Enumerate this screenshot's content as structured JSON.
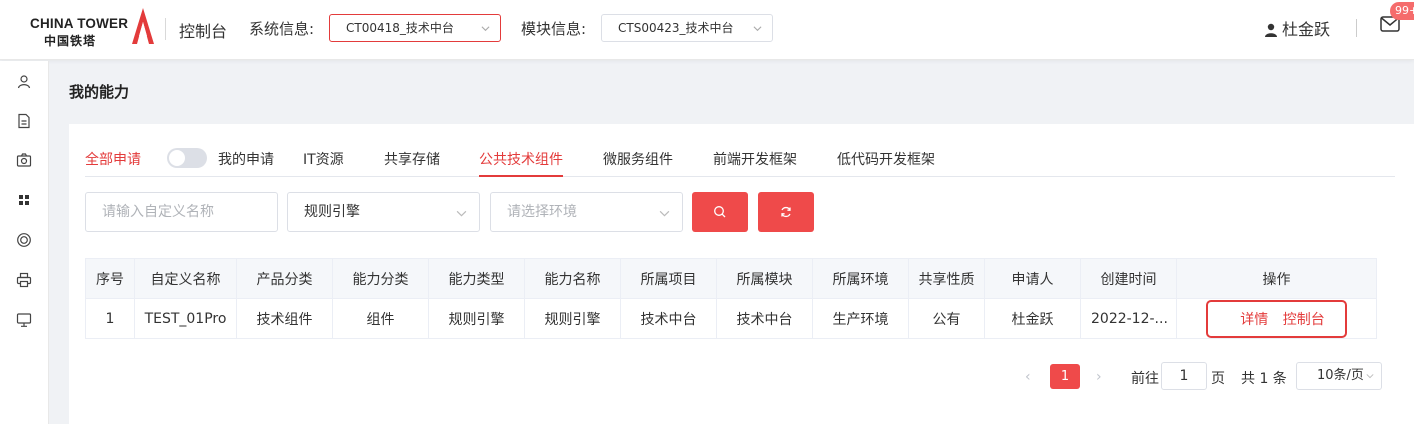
{
  "brand": {
    "name_en": "CHINA TOWER",
    "name_cn": "中国铁塔",
    "accent": "#e33b3b"
  },
  "header": {
    "console_title": "控制台",
    "system_label": "系统信息:",
    "system_value": "CT00418_技术中台",
    "module_label": "模块信息:",
    "module_value": "CTS00423_技术中台",
    "user_name": "杜金跃",
    "mail_badge": "99+"
  },
  "sidebar": {
    "icons": [
      "user-icon",
      "document-icon",
      "camera-icon",
      "grid-icon",
      "target-icon",
      "printer-icon",
      "monitor-icon"
    ]
  },
  "page": {
    "title": "我的能力"
  },
  "tabs": {
    "all_requests": "全部申请",
    "my_requests": "我的申请",
    "items": [
      "IT资源",
      "共享存储",
      "公共技术组件",
      "微服务组件",
      "前端开发框架",
      "低代码开发框架"
    ],
    "active": "公共技术组件"
  },
  "filters": {
    "name_placeholder": "请输入自定义名称",
    "category_value": "规则引擎",
    "env_placeholder": "请选择环境"
  },
  "table": {
    "headers": [
      "序号",
      "自定义名称",
      "产品分类",
      "能力分类",
      "能力类型",
      "能力名称",
      "所属项目",
      "所属模块",
      "所属环境",
      "共享性质",
      "申请人",
      "创建时间",
      "操作"
    ],
    "rows": [
      {
        "cells": [
          "1",
          "TEST_01Pro",
          "技术组件",
          "组件",
          "规则引擎",
          "规则引擎",
          "技术中台",
          "技术中台",
          "生产环境",
          "公有",
          "杜金跃",
          "2022-12-..."
        ],
        "actions": [
          "详情",
          "控制台"
        ]
      }
    ]
  },
  "pagination": {
    "current_page": "1",
    "goto_label": "前往",
    "goto_value": "1",
    "page_suffix": "页",
    "total": "共 1 条",
    "page_size": "10条/页"
  }
}
